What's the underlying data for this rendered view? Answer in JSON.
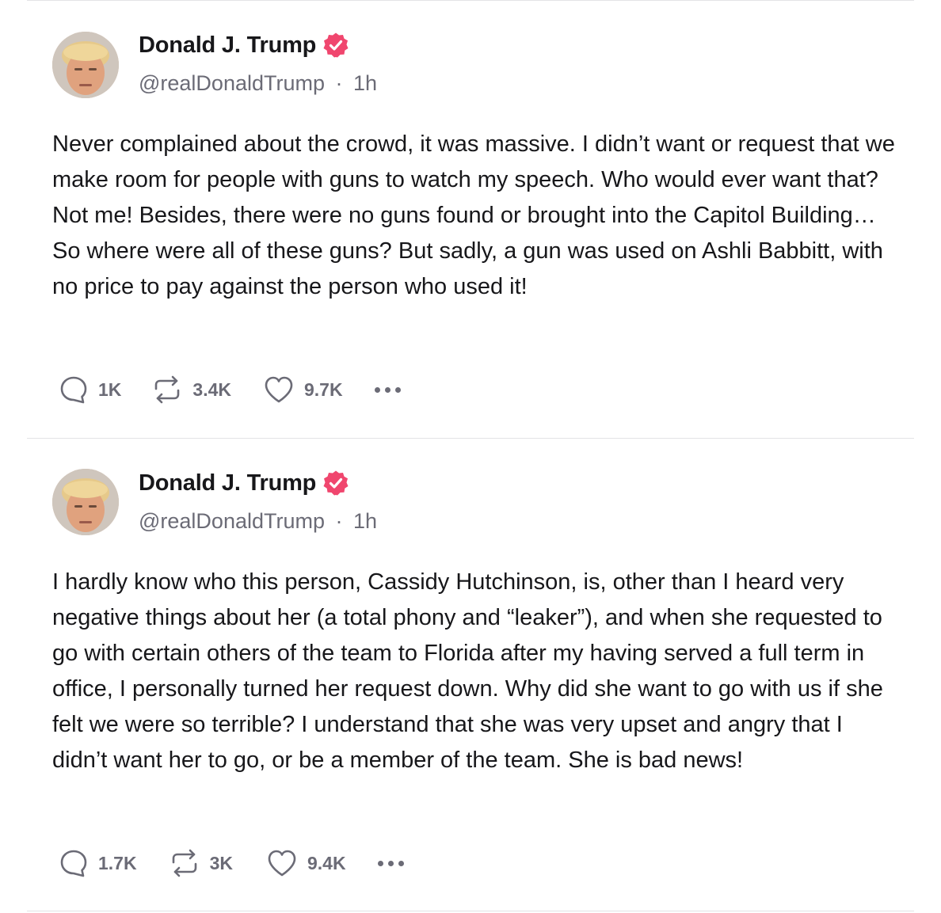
{
  "colors": {
    "verified_badge": "#f0466e",
    "muted_text": "#6b6b76",
    "divider": "#e3e3e6"
  },
  "posts": [
    {
      "author": {
        "display_name": "Donald J. Trump",
        "handle": "@realDonaldTrump",
        "separator": "·",
        "timestamp": "1h",
        "verified_icon": "verified-badge-icon"
      },
      "text": "Never complained about the crowd, it was massive. I didn’t want or request that we make room for people with guns to watch my speech. Who would ever want that? Not me! Besides, there were no guns found or brought into the Capitol Building…So where were all of these guns? But sadly, a gun was used on Ashli Babbitt, with no price to pay against the person who used it!",
      "actions": {
        "replies": "1K",
        "reposts": "3.4K",
        "likes": "9.7K"
      }
    },
    {
      "author": {
        "display_name": "Donald J. Trump",
        "handle": "@realDonaldTrump",
        "separator": "·",
        "timestamp": "1h",
        "verified_icon": "verified-badge-icon"
      },
      "text": "I hardly know who this person, Cassidy Hutchinson, is, other than I heard very negative things about her (a total phony and “leaker”), and when she requested to go with certain others of the team to Florida after my having served a full term in office, I personally turned her request down. Why did she want to go with us if she felt we were so terrible? I understand that she was very upset and angry that I didn’t want her to go, or be a member of the team. She is bad news!",
      "actions": {
        "replies": "1.7K",
        "reposts": "3K",
        "likes": "9.4K"
      }
    }
  ]
}
